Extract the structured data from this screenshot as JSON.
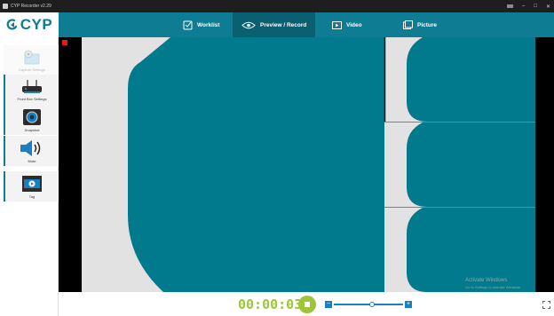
{
  "window": {
    "title": "CYP Recorder v2.29",
    "controls": {
      "minimize": "–",
      "maximize": "□",
      "close": "✕"
    }
  },
  "brand": {
    "logo_text": "CYP"
  },
  "nav": [
    {
      "label": "Worklist",
      "icon": "checklist-icon"
    },
    {
      "label": "Preview / Record",
      "icon": "eye-icon",
      "active": true
    },
    {
      "label": "Video",
      "icon": "play-icon"
    },
    {
      "label": "Picture",
      "icon": "picture-icon"
    }
  ],
  "sidebar": {
    "items": [
      {
        "label": "Capture Settings",
        "icon": "capture-settings-icon",
        "enabled": false
      },
      {
        "label": "Front Box Settings",
        "icon": "router-icon",
        "enabled": true
      },
      {
        "label": "Snapshot",
        "icon": "camera-icon",
        "enabled": true
      },
      {
        "label": "Mute",
        "icon": "speaker-icon",
        "enabled": true
      },
      {
        "label": "Tag",
        "icon": "tag-clip-icon",
        "enabled": true
      }
    ]
  },
  "recorder": {
    "timer": "00:00:03",
    "zoom_level": 0.55,
    "zoom_minus": "−",
    "zoom_plus": "+"
  },
  "watermark": {
    "line1": "Activate Windows",
    "line2": "Go to Settings to activate Windows."
  },
  "colors": {
    "brand": "#0e7c92",
    "nav_active": "#0a5f70",
    "preview_tile": "#007a8c",
    "record": "#e41b1b",
    "timer": "#9cc53a",
    "zoom": "#1e7fc0"
  }
}
